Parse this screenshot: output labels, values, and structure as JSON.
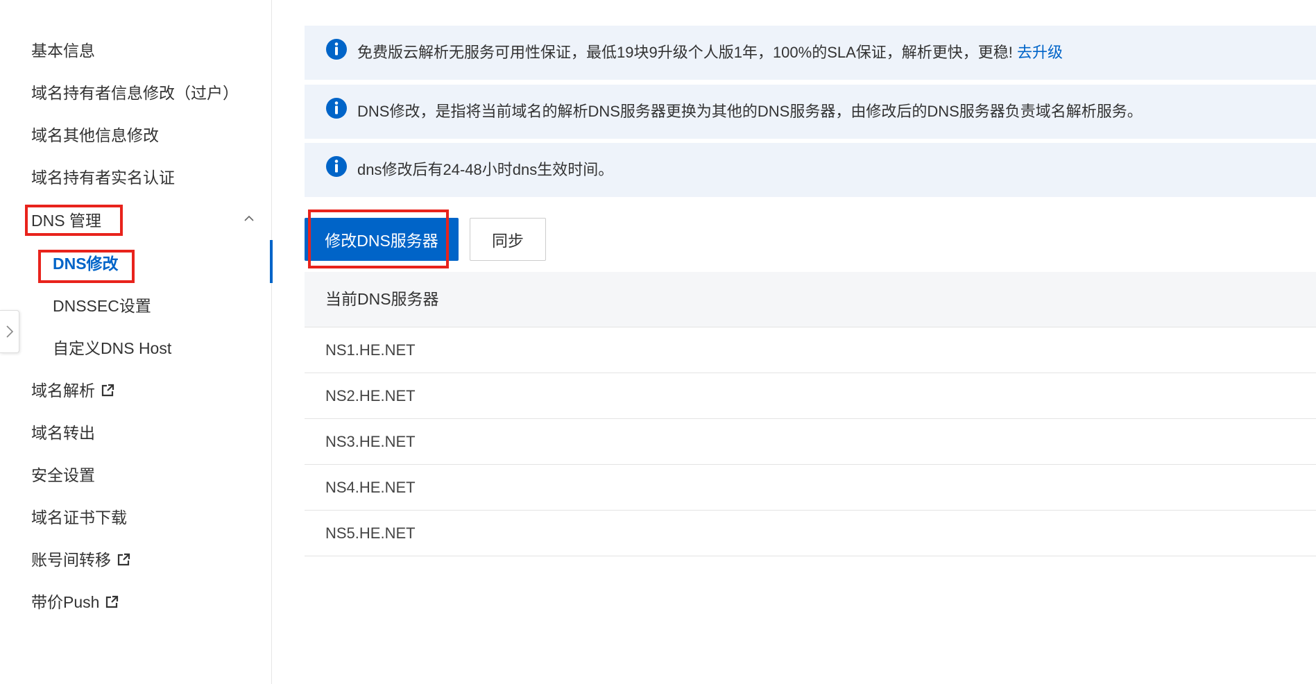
{
  "sidebar": {
    "items": [
      {
        "label": "基本信息"
      },
      {
        "label": "域名持有者信息修改（过户）"
      },
      {
        "label": "域名其他信息修改"
      },
      {
        "label": "域名持有者实名认证"
      },
      {
        "label": "DNS 管理",
        "expanded": true
      },
      {
        "label": "DNS修改",
        "active": true
      },
      {
        "label": "DNSSEC设置"
      },
      {
        "label": "自定义DNS Host"
      },
      {
        "label": "域名解析",
        "icon": "external-link-icon"
      },
      {
        "label": "域名转出"
      },
      {
        "label": "安全设置"
      },
      {
        "label": "域名证书下载"
      },
      {
        "label": "账号间转移",
        "icon": "external-link-icon"
      },
      {
        "label": "带价Push",
        "icon": "external-link-icon"
      }
    ]
  },
  "alerts": [
    {
      "text": "免费版云解析无服务可用性保证，最低19块9升级个人版1年，100%的SLA保证，解析更快，更稳!",
      "link": "去升级",
      "icon": "info-icon"
    },
    {
      "text": "DNS修改，是指将当前域名的解析DNS服务器更换为其他的DNS服务器，由修改后的DNS服务器负责域名解析服务。",
      "icon": "info-icon"
    },
    {
      "text": "dns修改后有24-48小时dns生效时间。",
      "icon": "info-icon"
    }
  ],
  "toolbar": {
    "modify_label": "修改DNS服务器",
    "sync_label": "同步"
  },
  "table": {
    "header": "当前DNS服务器",
    "rows": [
      "NS1.HE.NET",
      "NS2.HE.NET",
      "NS3.HE.NET",
      "NS4.HE.NET",
      "NS5.HE.NET"
    ]
  },
  "colors": {
    "accent": "#0064c8",
    "highlight_box": "#e8231c",
    "alert_bg": "#eef3fa"
  }
}
